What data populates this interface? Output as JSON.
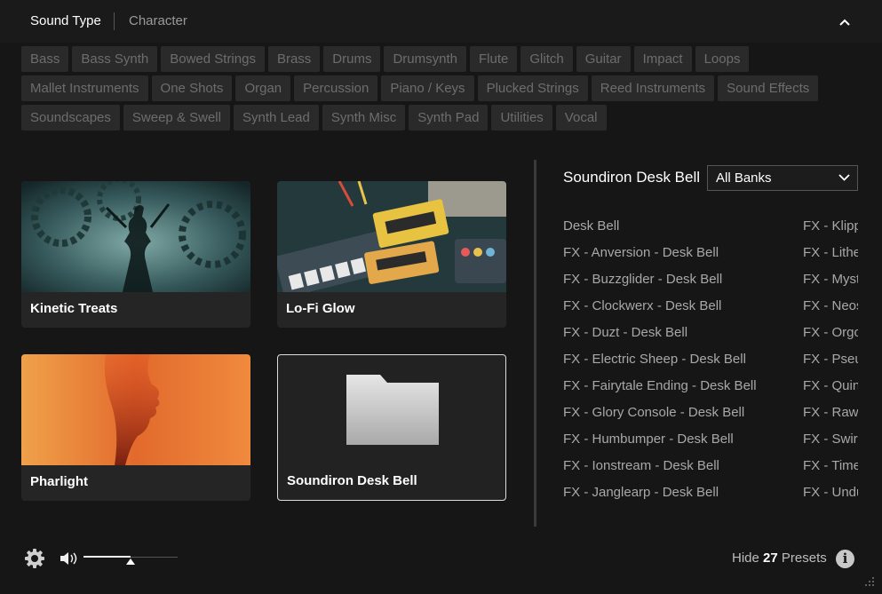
{
  "header": {
    "tab_active": "Sound Type",
    "tab_inactive": "Character"
  },
  "tags": [
    [
      "Bass",
      "Bass Synth",
      "Bowed Strings",
      "Brass",
      "Drums",
      "Drumsynth",
      "Flute",
      "Glitch",
      "Guitar",
      "Impact",
      "Loops"
    ],
    [
      "Mallet Instruments",
      "One Shots",
      "Organ",
      "Percussion",
      "Piano / Keys",
      "Plucked Strings",
      "Reed Instruments",
      "Sound Effects"
    ],
    [
      "Soundscapes",
      "Sweep & Swell",
      "Synth Lead",
      "Synth Misc",
      "Synth Pad",
      "Utilities",
      "Vocal"
    ]
  ],
  "cards": [
    {
      "title": "Kinetic Treats"
    },
    {
      "title": "Lo-Fi Glow"
    },
    {
      "title": "Pharlight"
    },
    {
      "title": "Soundiron Desk Bell"
    }
  ],
  "panel": {
    "title": "Soundiron Desk Bell",
    "bank_selected": "All Banks"
  },
  "presets_col1": [
    "Desk Bell",
    "FX - Anversion - Desk Bell",
    "FX - Buzzglider - Desk Bell",
    "FX - Clockwerx - Desk Bell",
    "FX - Duzt - Desk Bell",
    "FX - Electric Sheep - Desk Bell",
    "FX - Fairytale Ending - Desk Bell",
    "FX - Glory Console - Desk Bell",
    "FX - Humbumper - Desk Bell",
    "FX - Ionstream - Desk Bell",
    "FX - Janglearp - Desk Bell"
  ],
  "presets_col2": [
    "FX - Klipp",
    "FX - Lithe",
    "FX - Myst",
    "FX - Neos",
    "FX - Orgo",
    "FX - Pseu",
    "FX - Quin",
    "FX - Rawg",
    "FX - Swirl",
    "FX - Time",
    "FX - Undu"
  ],
  "footer": {
    "volume_level": 0.5,
    "hide_label": "Hide",
    "preset_count": "27",
    "presets_label": "Presets"
  },
  "icons": {
    "collapse": "chevron-up-icon",
    "settings": "gear-icon",
    "volume": "speaker-icon",
    "info": "info-icon",
    "resize": "resize-grip-icon",
    "folder": "folder-icon"
  }
}
